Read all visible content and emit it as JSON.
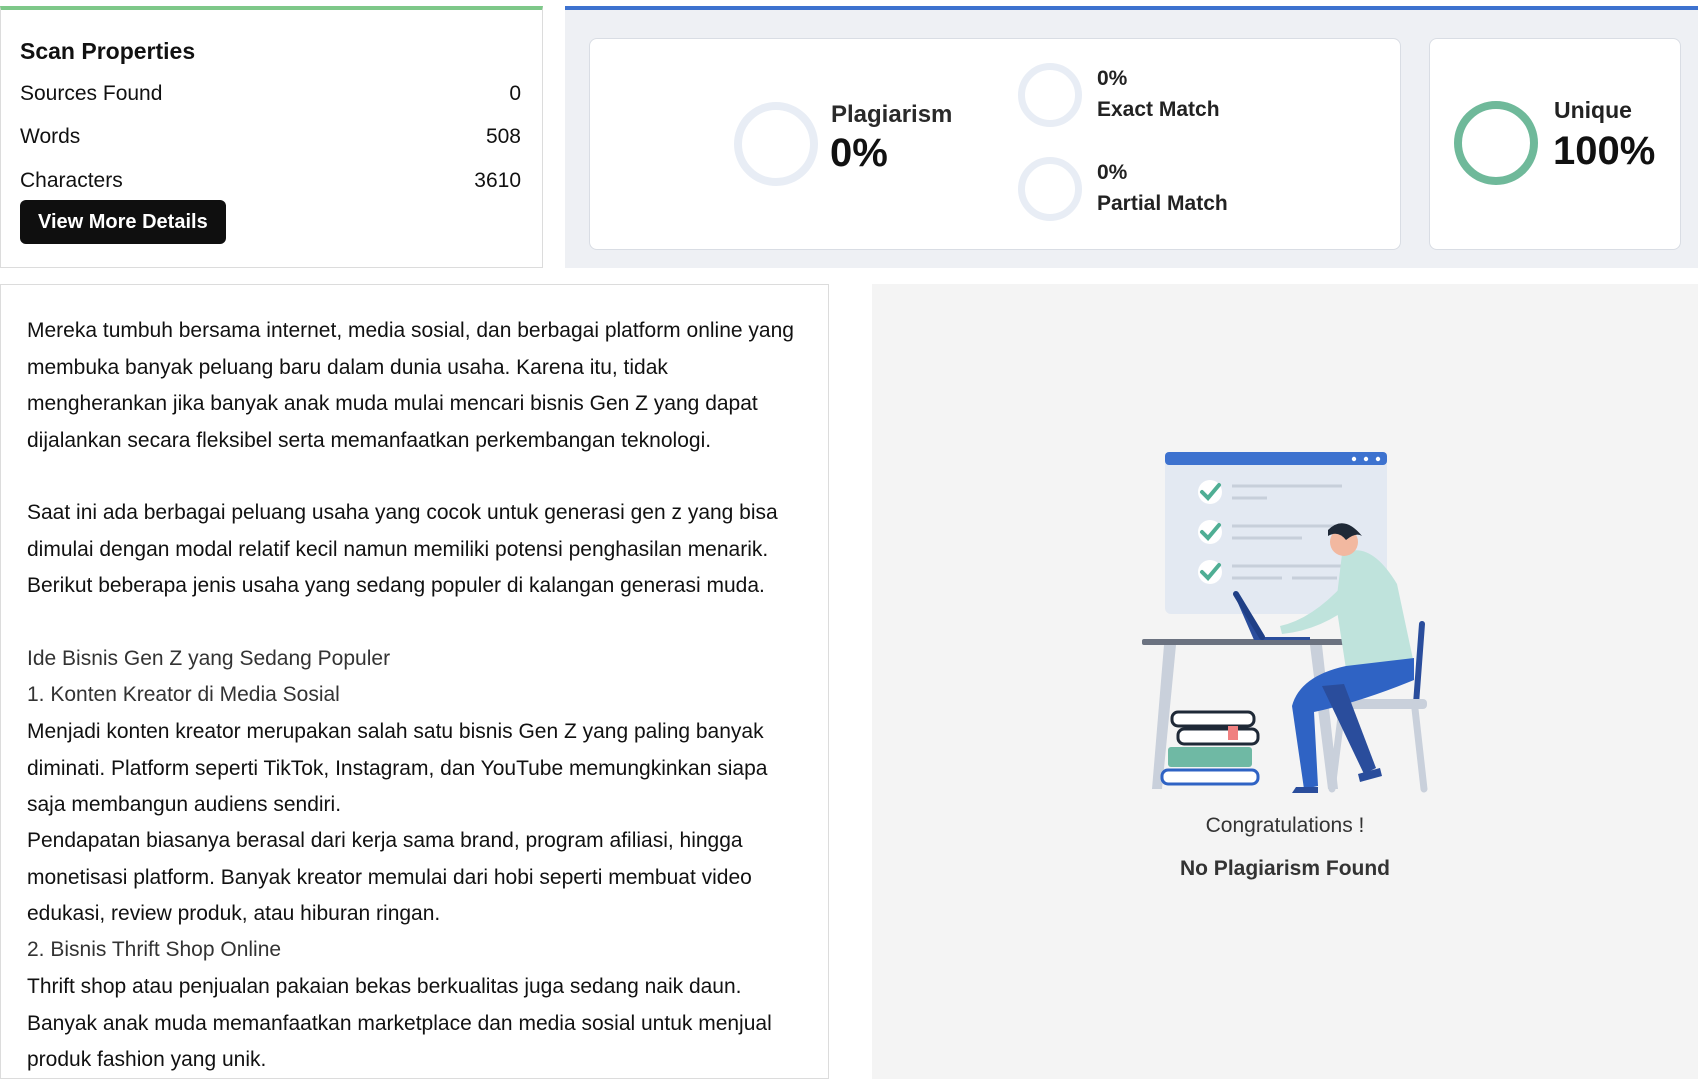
{
  "scan_properties": {
    "title": "Scan Properties",
    "rows": [
      {
        "label": "Sources Found",
        "value": "0"
      },
      {
        "label": "Words",
        "value": "508"
      },
      {
        "label": "Characters",
        "value": "3610"
      }
    ],
    "button_label": "View More Details"
  },
  "results": {
    "plagiarism": {
      "label": "Plagiarism",
      "value": "0%"
    },
    "exact_match": {
      "value": "0%",
      "label": "Exact Match"
    },
    "partial_match": {
      "value": "0%",
      "label": "Partial Match"
    },
    "unique": {
      "label": "Unique",
      "value": "100%"
    }
  },
  "content": {
    "paragraphs": [
      "Mereka tumbuh bersama internet, media sosial, dan berbagai platform online yang membuka banyak peluang baru dalam dunia usaha. Karena itu, tidak mengherankan jika banyak anak muda mulai mencari bisnis Gen Z yang dapat dijalankan secara fleksibel serta memanfaatkan perkembangan teknologi.",
      "Saat ini ada berbagai peluang usaha yang cocok untuk generasi gen z yang bisa dimulai dengan modal relatif kecil namun memiliki potensi penghasilan menarik. Berikut beberapa jenis usaha yang sedang populer di kalangan generasi muda.",
      "Ide Bisnis Gen Z yang Sedang Populer",
      "1. Konten Kreator di Media Sosial",
      "Menjadi konten kreator merupakan salah satu bisnis Gen Z yang paling banyak diminati. Platform seperti TikTok, Instagram, dan YouTube memungkinkan siapa saja membangun audiens sendiri.",
      "Pendapatan biasanya berasal dari kerja sama brand, program afiliasi, hingga monetisasi platform. Banyak kreator memulai dari hobi seperti membuat video edukasi, review produk, atau hiburan ringan.",
      "2. Bisnis Thrift Shop Online",
      "Thrift shop atau penjualan pakaian bekas berkualitas juga sedang naik daun. Banyak anak muda memanfaatkan marketplace dan media sosial untuk menjual produk fashion yang unik."
    ]
  },
  "illustration": {
    "congrats": "Congratulations !",
    "message": "No Plagiarism Found"
  },
  "colors": {
    "scan_accent": "#7ec889",
    "result_accent": "#3d72cf",
    "unique_ring": "#6fb99a",
    "ring_empty": "#e8edf5"
  }
}
